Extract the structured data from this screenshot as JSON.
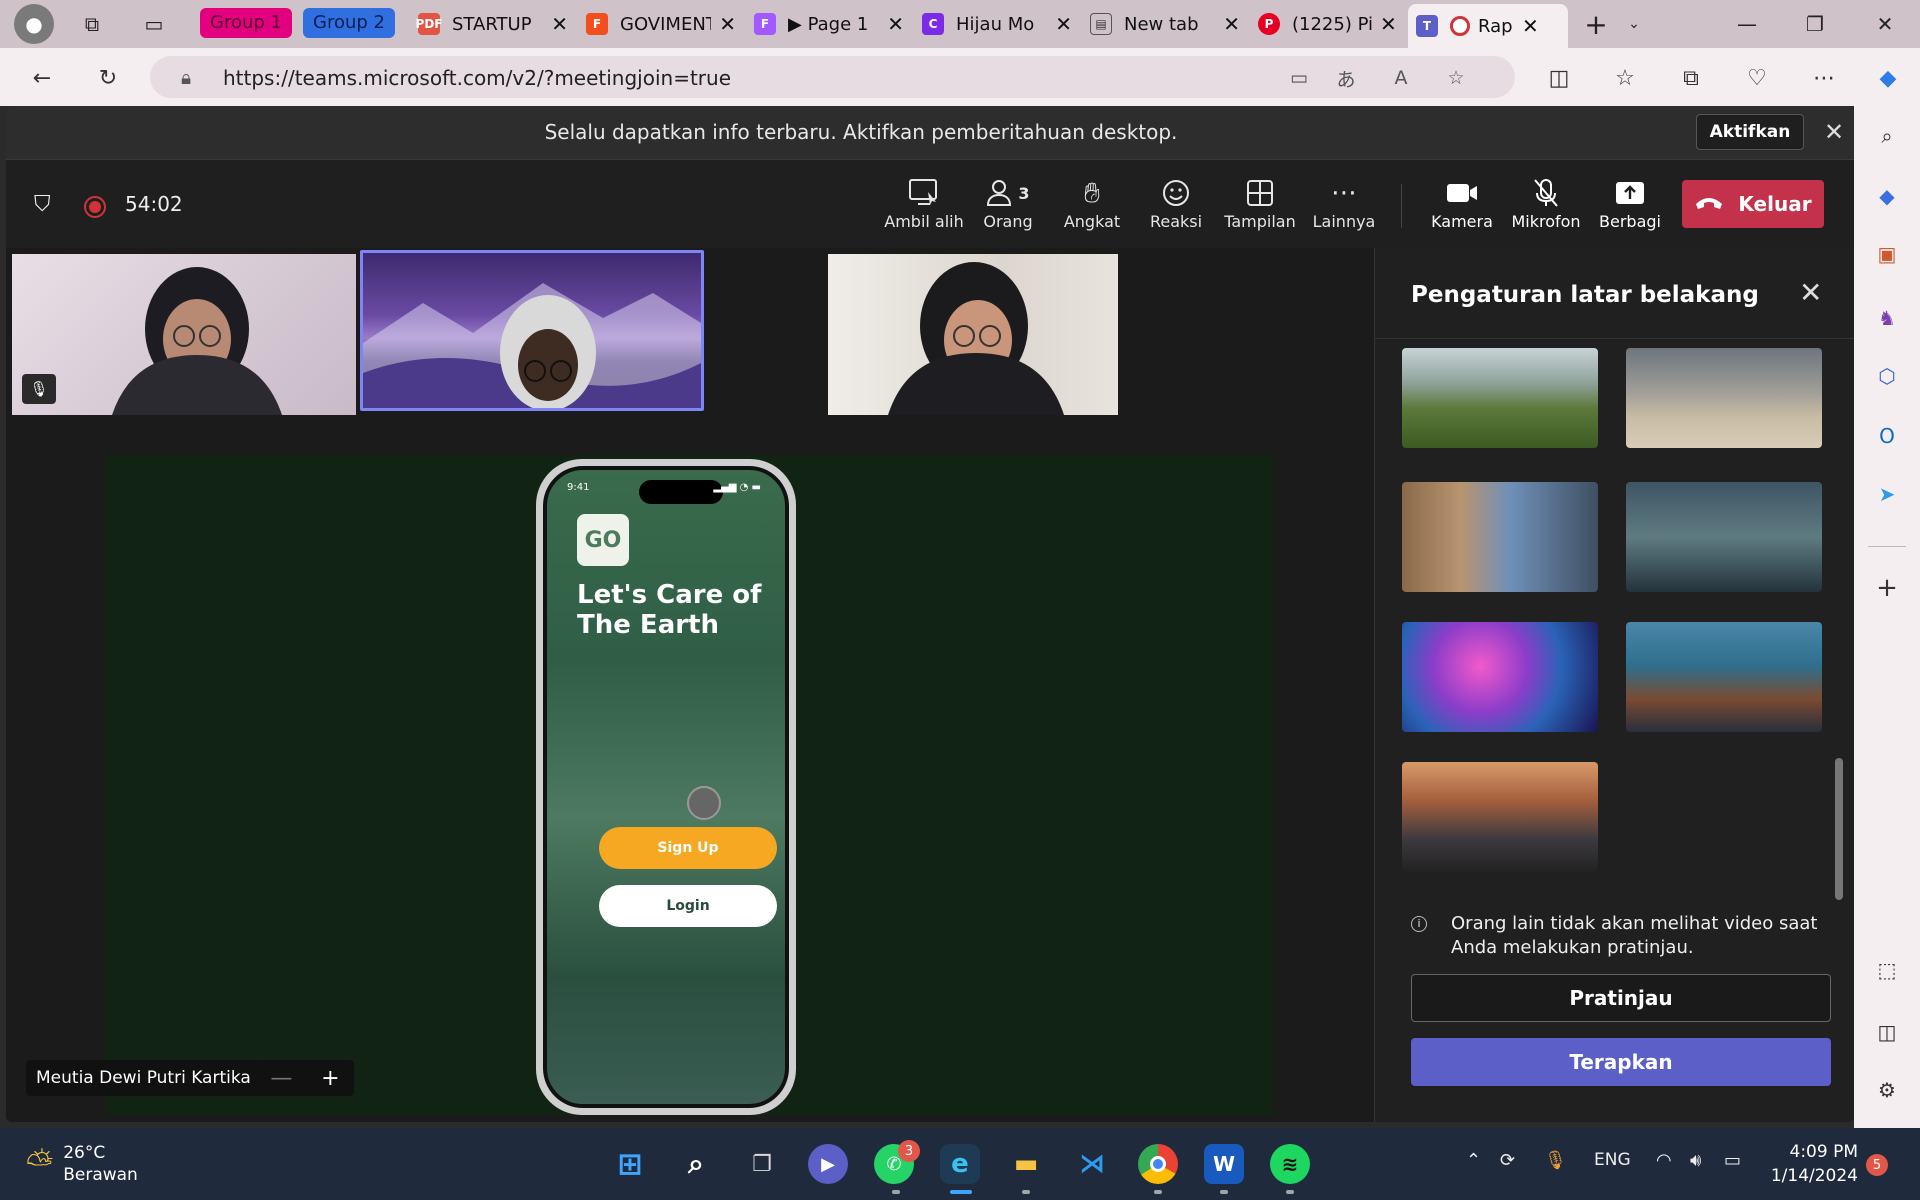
{
  "browser": {
    "groups": [
      {
        "label": "Group 1",
        "color": "#e3007f"
      },
      {
        "label": "Group 2",
        "color": "#2f6fe0"
      }
    ],
    "tabs": [
      {
        "title": "STARTUP",
        "icon": "pdf-icon"
      },
      {
        "title": "GOVIMENT",
        "icon": "figma-icon"
      },
      {
        "title": "▶ Page 1",
        "icon": "figma-icon"
      },
      {
        "title": "Hijau Mo",
        "icon": "canva-icon"
      },
      {
        "title": "New tab",
        "icon": "new-tab-icon"
      },
      {
        "title": "(1225) Pi",
        "icon": "pinterest-icon"
      },
      {
        "title": "Rap",
        "icon": "teams-icon",
        "active": true
      }
    ],
    "url": "https://teams.microsoft.com/v2/?meetingjoin=true"
  },
  "teams": {
    "notification": {
      "message": "Selalu dapatkan info terbaru. Aktifkan pemberitahuan desktop.",
      "action": "Aktifkan"
    },
    "meeting": {
      "timer": "54:02",
      "people_count": "3",
      "tools": [
        {
          "label": "Ambil alih",
          "icon": "take-control-icon"
        },
        {
          "label": "Orang",
          "icon": "people-icon"
        },
        {
          "label": "Angkat",
          "icon": "raise-hand-icon"
        },
        {
          "label": "Reaksi",
          "icon": "reaction-icon"
        },
        {
          "label": "Tampilan",
          "icon": "view-icon"
        },
        {
          "label": "Lainnya",
          "icon": "more-icon"
        },
        {
          "label": "Kamera",
          "icon": "camera-icon"
        },
        {
          "label": "Mikrofon",
          "icon": "mic-off-icon"
        },
        {
          "label": "Berbagi",
          "icon": "share-icon"
        }
      ],
      "leave_label": "Keluar"
    },
    "share": {
      "presenter_name": "Meutia Dewi Putri Kartika",
      "phone": {
        "time": "9:41",
        "logo": "GO",
        "headline": "Let's Care of The Earth",
        "signup": "Sign Up",
        "login": "Login",
        "signup_color": "#f7a823"
      }
    },
    "background_panel": {
      "title": "Pengaturan latar belakang",
      "thumbnails": [
        "mountain-valley",
        "ruined-stadium",
        "fantasy-street",
        "space-station",
        "nebula",
        "alien-shore",
        "village-road"
      ],
      "info": "Orang lain tidak akan melihat video saat Anda melakukan pratinjau.",
      "preview_label": "Pratinjau",
      "apply_label": "Terapkan"
    }
  },
  "taskbar": {
    "weather": {
      "temp": "26°C",
      "desc": "Berawan"
    },
    "whatsapp_badge": "3",
    "language": "ENG",
    "time": "4:09 PM",
    "date": "1/14/2024",
    "notif_count": "5"
  }
}
